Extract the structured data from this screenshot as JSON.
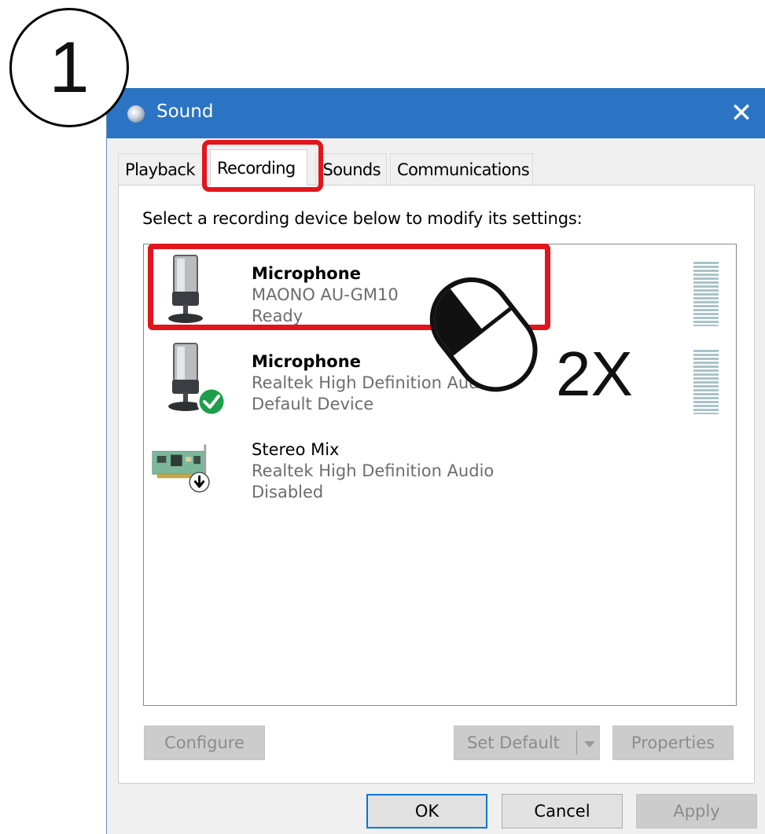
{
  "annotation": {
    "step_number": "1",
    "click_count_label": "2X"
  },
  "window": {
    "title": "Sound",
    "close_glyph": "✕"
  },
  "tabs": [
    {
      "label": "Playback",
      "active": false
    },
    {
      "label": "Recording",
      "active": true
    },
    {
      "label": "Sounds",
      "active": false
    },
    {
      "label": "Communications",
      "active": false
    }
  ],
  "instruction": "Select a recording device below to modify its settings:",
  "devices": [
    {
      "name": "Microphone",
      "description": "MAONO AU-GM10",
      "status": "Ready",
      "icon": "microphone-icon"
    },
    {
      "name": "Microphone",
      "description": "Realtek High Definition Audio",
      "status": "Default Device",
      "icon": "microphone-icon",
      "badge": "green-check-icon"
    },
    {
      "name": "Stereo Mix",
      "description": "Realtek High Definition Audio",
      "status": "Disabled",
      "icon": "sound-card-icon",
      "badge": "down-arrow-icon"
    }
  ],
  "buttons": {
    "configure": "Configure",
    "set_default": "Set Default",
    "properties": "Properties",
    "ok": "OK",
    "cancel": "Cancel",
    "apply": "Apply"
  },
  "colors": {
    "titlebar": "#2b74c3",
    "highlight": "#e2151c",
    "default_check": "#16a34a"
  }
}
